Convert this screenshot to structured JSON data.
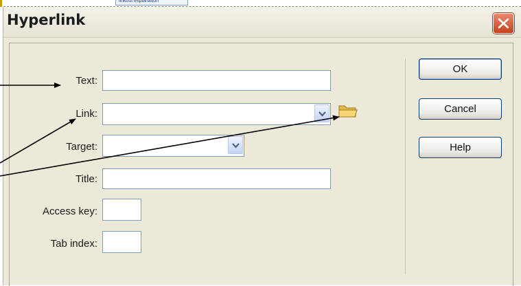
{
  "background_strip": {
    "tooltip_text": "linkout explanation"
  },
  "dialog": {
    "title": "Hyperlink",
    "close_icon": "close-x-icon",
    "fields": {
      "text": {
        "label": "Text:",
        "value": ""
      },
      "link": {
        "label": "Link:",
        "value": ""
      },
      "target": {
        "label": "Target:",
        "value": ""
      },
      "title": {
        "label": "Title:",
        "value": ""
      },
      "access_key": {
        "label": "Access key:",
        "value": ""
      },
      "tab_index": {
        "label": "Tab index:",
        "value": ""
      }
    },
    "browse_icon": "folder-icon",
    "buttons": {
      "ok": "OK",
      "cancel": "Cancel",
      "help": "Help"
    }
  },
  "colors": {
    "dialog_bg": "#ece9d8",
    "close_button": "#c6401d",
    "button_border": "#003c74",
    "field_border": "#7f9db9"
  }
}
